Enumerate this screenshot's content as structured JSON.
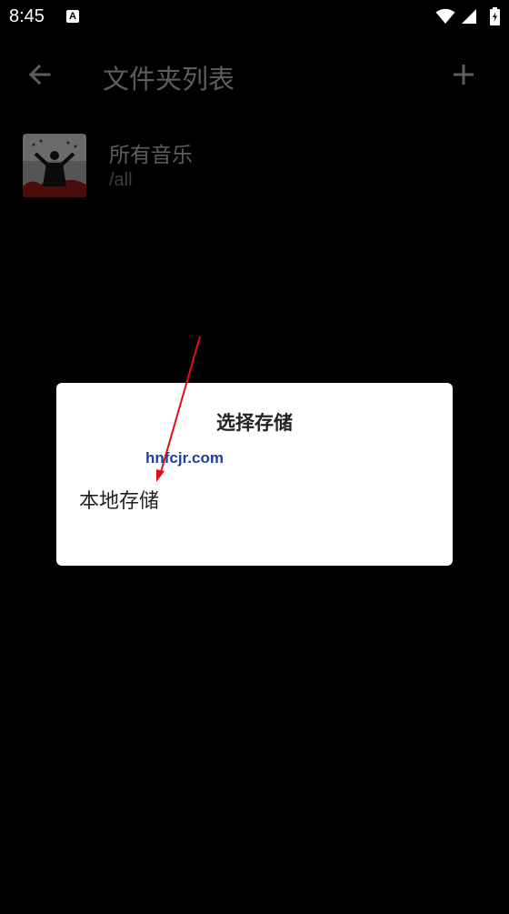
{
  "status_bar": {
    "time": "8:45",
    "notification_icon": "A"
  },
  "app_bar": {
    "title": "文件夹列表",
    "back_icon": "arrow-back-icon",
    "add_icon": "plus-icon"
  },
  "folders": [
    {
      "name": "所有音乐",
      "path": "/all"
    }
  ],
  "dialog": {
    "title": "选择存储",
    "options": [
      "本地存储"
    ]
  },
  "watermark": {
    "text": "hnfcjr.com"
  },
  "colors": {
    "background": "#000000",
    "dimmed_text": "#5d5d5d",
    "dialog_background": "#ffffff",
    "watermark_blue": "#1c3fa8",
    "watermark_arrow_red": "#e0101a"
  }
}
